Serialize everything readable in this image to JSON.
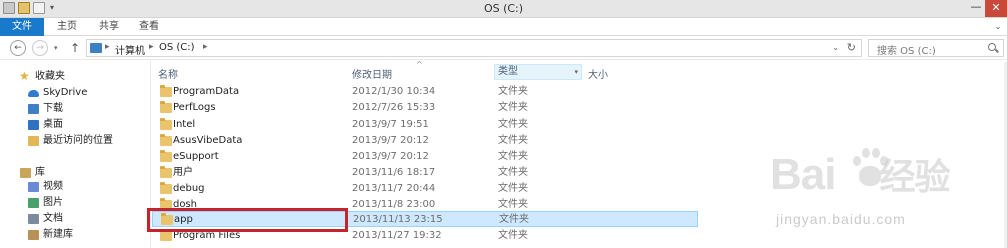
{
  "window": {
    "title": "OS (C:)",
    "minimize": "—",
    "close": "✕"
  },
  "ribbon": {
    "tabs": [
      "文件",
      "主页",
      "共享",
      "查看"
    ],
    "toggle": "⌄"
  },
  "address": {
    "crumbs": [
      "计算机",
      "OS (C:)"
    ],
    "separator": "▸",
    "dropdown": "⌄",
    "refresh": "↻"
  },
  "search": {
    "placeholder": "搜索 OS (C:)"
  },
  "nav": {
    "favorites_label": "收藏夹",
    "favorites": [
      "SkyDrive",
      "下载",
      "桌面",
      "最近访问的位置"
    ],
    "library_label": "库",
    "libraries": [
      "视频",
      "图片",
      "文档",
      "新建库"
    ]
  },
  "columns": {
    "name": "名称",
    "date": "修改日期",
    "type": "类型",
    "size": "大小",
    "sort_indicator": "^",
    "type_dropdown": "▾"
  },
  "files": [
    {
      "name": "ProgramData",
      "date": "2012/1/30 10:34",
      "type": "文件夹"
    },
    {
      "name": "PerfLogs",
      "date": "2012/7/26 15:33",
      "type": "文件夹"
    },
    {
      "name": "Intel",
      "date": "2013/9/7 19:51",
      "type": "文件夹"
    },
    {
      "name": "AsusVibeData",
      "date": "2013/9/7 20:12",
      "type": "文件夹"
    },
    {
      "name": "eSupport",
      "date": "2013/9/7 20:12",
      "type": "文件夹"
    },
    {
      "name": "用户",
      "date": "2013/11/6 18:17",
      "type": "文件夹"
    },
    {
      "name": "debug",
      "date": "2013/11/7 20:44",
      "type": "文件夹"
    },
    {
      "name": "dosh",
      "date": "2013/11/8 23:00",
      "type": "文件夹"
    },
    {
      "name": "app",
      "date": "2013/11/13 23:15",
      "type": "文件夹",
      "selected": true
    },
    {
      "name": "Program Files",
      "date": "2013/11/27 19:32",
      "type": "文件夹"
    }
  ],
  "watermark": {
    "main_left": "Bai",
    "main_right": "经验",
    "sub": "jingyan.baidu.com"
  }
}
